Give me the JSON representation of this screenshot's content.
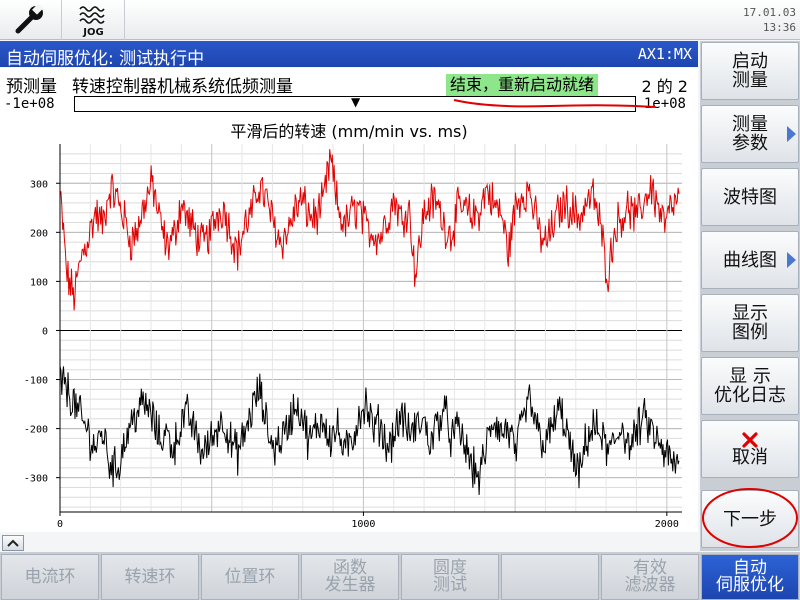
{
  "header": {
    "mode_label": "JOG",
    "date": "17.01.03",
    "time": "13:36"
  },
  "title_bar": {
    "title": "自动伺服优化: 测试执行中",
    "axis": "AX1:MX"
  },
  "measurement": {
    "prefix": "预测量",
    "name": "转速控制器机械系统低频测量",
    "status": "结束，重新启动就绪",
    "step": "2 的 2",
    "range_min": "-1e+08",
    "range_max": "1e+08"
  },
  "chart_data": {
    "type": "line",
    "title": "平滑后的转速 (mm/min vs. ms)",
    "xlabel": "",
    "ylabel": "",
    "xlim": [
      0,
      2050
    ],
    "ylim": [
      -370,
      380
    ],
    "x_ticks": [
      "0",
      "1000",
      "2000"
    ],
    "y_ticks": [
      "300",
      "200",
      "100",
      "0",
      "-100",
      "-200",
      "-300"
    ],
    "grid": true,
    "series": [
      {
        "color": "#e00000",
        "mean": 205,
        "amplitude": 65,
        "values": [
          280,
          110,
          70,
          150,
          190,
          240,
          215,
          290,
          270,
          230,
          180,
          210,
          265,
          300,
          225,
          170,
          190,
          260,
          225,
          200,
          175,
          195,
          235,
          250,
          200,
          160,
          215,
          240,
          300,
          265,
          220,
          180,
          200,
          245,
          265,
          235,
          230,
          260,
          350,
          255,
          210,
          240,
          250,
          210,
          200,
          190,
          230,
          270,
          225,
          255,
          110,
          230,
          260,
          260,
          215,
          195,
          250,
          245,
          230,
          245,
          290,
          255,
          240,
          160,
          250,
          280,
          285,
          220,
          175,
          200,
          240,
          260,
          245,
          230,
          260,
          275,
          210,
          110,
          210,
          235,
          250,
          225,
          260,
          295,
          255,
          215,
          250,
          265
        ]
      },
      {
        "color": "#000000",
        "mean": -205,
        "amplitude": 65,
        "values": [
          -100,
          -120,
          -150,
          -180,
          -210,
          -240,
          -205,
          -270,
          -285,
          -230,
          -190,
          -160,
          -150,
          -180,
          -220,
          -210,
          -240,
          -190,
          -170,
          -210,
          -250,
          -230,
          -200,
          -180,
          -230,
          -250,
          -210,
          -160,
          -120,
          -190,
          -240,
          -220,
          -200,
          -150,
          -170,
          -230,
          -200,
          -180,
          -220,
          -200,
          -250,
          -230,
          -170,
          -150,
          -200,
          -190,
          -240,
          -210,
          -170,
          -210,
          -200,
          -180,
          -230,
          -190,
          -160,
          -220,
          -200,
          -240,
          -280,
          -300,
          -230,
          -180,
          -210,
          -200,
          -250,
          -190,
          -140,
          -200,
          -230,
          -210,
          -160,
          -190,
          -260,
          -300,
          -220,
          -200,
          -210,
          -250,
          -230,
          -190,
          -240,
          -210,
          -180,
          -200,
          -230,
          -250,
          -270,
          -280
        ]
      }
    ]
  },
  "softkeys_vertical": {
    "start": "启动\n测量",
    "params": "测量\n参数",
    "bode": "波特图",
    "curve": "曲线图",
    "legend": "显示\n图例",
    "log": "显 示\n优化日志",
    "cancel": "取消",
    "next": "下一步"
  },
  "softkeys_horizontal": {
    "current_loop": "电流环",
    "speed_loop": "转速环",
    "position_loop": "位置环",
    "func_gen": "函数\n发生器",
    "circularity": "圆度\n测试",
    "blank": "",
    "filter": "有效\n滤波器",
    "auto_servo": "自动\n伺服优化"
  },
  "colors": {
    "title_blue": "#2a58c9",
    "status_green": "#8ee68a",
    "cancel_red": "#e00000"
  }
}
